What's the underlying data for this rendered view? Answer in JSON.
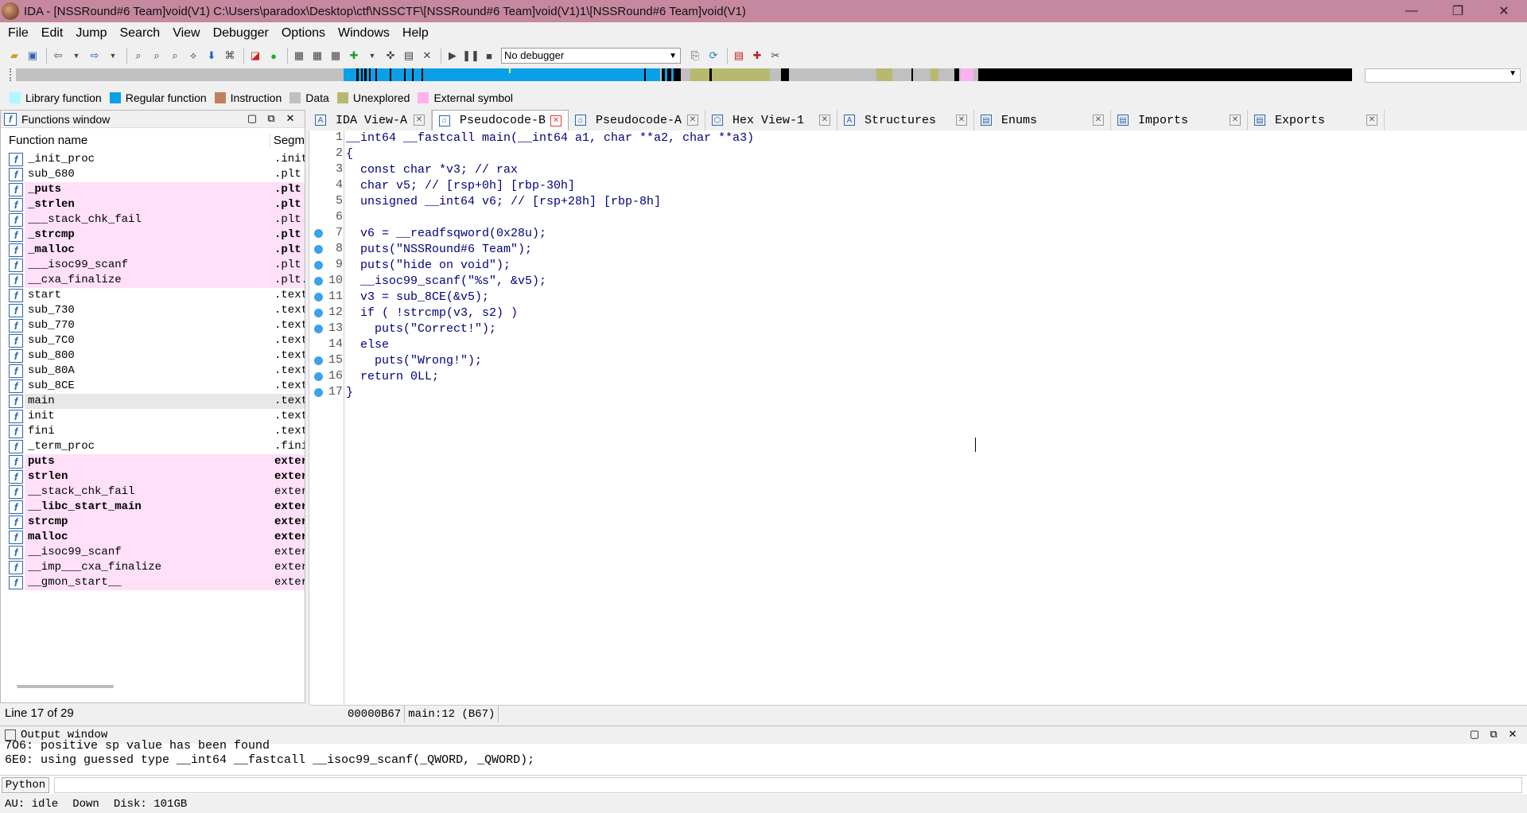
{
  "titlebar": {
    "title": "IDA - [NSSRound#6 Team]void(V1) C:\\Users\\paradox\\Desktop\\ctf\\NSSCTF\\[NSSRound#6 Team]void(V1)1\\[NSSRound#6 Team]void(V1)",
    "minimize": "—",
    "restore": "❐",
    "close": "✕"
  },
  "menu": [
    "File",
    "Edit",
    "Jump",
    "Search",
    "View",
    "Debugger",
    "Options",
    "Windows",
    "Help"
  ],
  "toolbar": {
    "debugger_select": "No debugger"
  },
  "legend": [
    {
      "label": "Library function",
      "color": "#b0f8ff"
    },
    {
      "label": "Regular function",
      "color": "#0aa0e8"
    },
    {
      "label": "Instruction",
      "color": "#c08060"
    },
    {
      "label": "Data",
      "color": "#c0c0c0"
    },
    {
      "label": "Unexplored",
      "color": "#b8b870"
    },
    {
      "label": "External symbol",
      "color": "#ffb0f0"
    }
  ],
  "functions_window": {
    "title": "Functions window",
    "col_name": "Function name",
    "col_segment": "Segm",
    "rows": [
      {
        "name": "_init_proc",
        "seg": ".init",
        "ext": false,
        "bold": false
      },
      {
        "name": "sub_680",
        "seg": ".plt",
        "ext": false,
        "bold": false
      },
      {
        "name": "_puts",
        "seg": ".plt",
        "ext": true,
        "bold": true
      },
      {
        "name": "_strlen",
        "seg": ".plt",
        "ext": true,
        "bold": true
      },
      {
        "name": "___stack_chk_fail",
        "seg": ".plt",
        "ext": true,
        "bold": false
      },
      {
        "name": "_strcmp",
        "seg": ".plt",
        "ext": true,
        "bold": true
      },
      {
        "name": "_malloc",
        "seg": ".plt",
        "ext": true,
        "bold": true
      },
      {
        "name": "___isoc99_scanf",
        "seg": ".plt",
        "ext": true,
        "bold": false
      },
      {
        "name": "__cxa_finalize",
        "seg": ".plt.",
        "ext": true,
        "bold": false
      },
      {
        "name": "start",
        "seg": ".text",
        "ext": false,
        "bold": false
      },
      {
        "name": "sub_730",
        "seg": ".text",
        "ext": false,
        "bold": false
      },
      {
        "name": "sub_770",
        "seg": ".text",
        "ext": false,
        "bold": false
      },
      {
        "name": "sub_7C0",
        "seg": ".text",
        "ext": false,
        "bold": false
      },
      {
        "name": "sub_800",
        "seg": ".text",
        "ext": false,
        "bold": false
      },
      {
        "name": "sub_80A",
        "seg": ".text",
        "ext": false,
        "bold": false
      },
      {
        "name": "sub_8CE",
        "seg": ".text",
        "ext": false,
        "bold": false
      },
      {
        "name": "main",
        "seg": ".text",
        "ext": false,
        "bold": false,
        "selected": true
      },
      {
        "name": "init",
        "seg": ".text",
        "ext": false,
        "bold": false
      },
      {
        "name": "fini",
        "seg": ".text",
        "ext": false,
        "bold": false
      },
      {
        "name": "_term_proc",
        "seg": ".fini",
        "ext": false,
        "bold": false
      },
      {
        "name": "puts",
        "seg": "exter",
        "ext": true,
        "bold": true
      },
      {
        "name": "strlen",
        "seg": "exter",
        "ext": true,
        "bold": true
      },
      {
        "name": "__stack_chk_fail",
        "seg": "exter",
        "ext": true,
        "bold": false
      },
      {
        "name": "__libc_start_main",
        "seg": "exter",
        "ext": true,
        "bold": true
      },
      {
        "name": "strcmp",
        "seg": "exter",
        "ext": true,
        "bold": true
      },
      {
        "name": "malloc",
        "seg": "exter",
        "ext": true,
        "bold": true
      },
      {
        "name": "__isoc99_scanf",
        "seg": "exter",
        "ext": true,
        "bold": false
      },
      {
        "name": "__imp___cxa_finalize",
        "seg": "exter",
        "ext": true,
        "bold": false
      },
      {
        "name": "__gmon_start__",
        "seg": "exter",
        "ext": true,
        "bold": false
      }
    ],
    "status": "Line 17 of 29"
  },
  "tabs": [
    {
      "label": "IDA View-A",
      "icon": "A",
      "active": false
    },
    {
      "label": "Pseudocode-B",
      "icon": "⌂",
      "active": true
    },
    {
      "label": "Pseudocode-A",
      "icon": "⌂",
      "active": false
    },
    {
      "label": "Hex View-1",
      "icon": "⬡",
      "active": false
    },
    {
      "label": "Structures",
      "icon": "A",
      "active": false
    },
    {
      "label": "Enums",
      "icon": "▤",
      "active": false
    },
    {
      "label": "Imports",
      "icon": "▤",
      "active": false
    },
    {
      "label": "Exports",
      "icon": "▤",
      "active": false
    }
  ],
  "code": {
    "lines": [
      {
        "n": "1",
        "bp": false,
        "text": "__int64 __fastcall main(__int64 a1, char **a2, char **a3)"
      },
      {
        "n": "2",
        "bp": false,
        "text": "{"
      },
      {
        "n": "3",
        "bp": false,
        "text": "  const char *v3; // rax"
      },
      {
        "n": "4",
        "bp": false,
        "text": "  char v5; // [rsp+0h] [rbp-30h]"
      },
      {
        "n": "5",
        "bp": false,
        "text": "  unsigned __int64 v6; // [rsp+28h] [rbp-8h]"
      },
      {
        "n": "6",
        "bp": false,
        "text": ""
      },
      {
        "n": "7",
        "bp": true,
        "text": "  v6 = __readfsqword(0x28u);"
      },
      {
        "n": "8",
        "bp": true,
        "text": "  puts(\"NSSRound#6 Team\");"
      },
      {
        "n": "9",
        "bp": true,
        "text": "  puts(\"hide on void\");"
      },
      {
        "n": "10",
        "bp": true,
        "text": "  __isoc99_scanf(\"%s\", &v5);"
      },
      {
        "n": "11",
        "bp": true,
        "text": "  v3 = sub_8CE(&v5);"
      },
      {
        "n": "12",
        "bp": true,
        "text": "  if ( !strcmp(v3, s2) )"
      },
      {
        "n": "13",
        "bp": true,
        "text": "    puts(\"Correct!\");"
      },
      {
        "n": "14",
        "bp": false,
        "text": "  else"
      },
      {
        "n": "15",
        "bp": true,
        "text": "    puts(\"Wrong!\");"
      },
      {
        "n": "16",
        "bp": true,
        "text": "  return 0LL;"
      },
      {
        "n": "17",
        "bp": true,
        "text": "}"
      }
    ],
    "status_addr": "00000B67",
    "status_loc": "main:12 (B67)"
  },
  "output": {
    "title": "Output window",
    "lines": [
      "7O6: positive sp value has been found",
      "6E0: using guessed type __int64 __fastcall __isoc99_scanf(_QWORD, _QWORD);"
    ],
    "python_label": "Python"
  },
  "statusbar": {
    "au": "AU:  idle",
    "dir": "Down",
    "disk": "Disk: 101GB"
  }
}
